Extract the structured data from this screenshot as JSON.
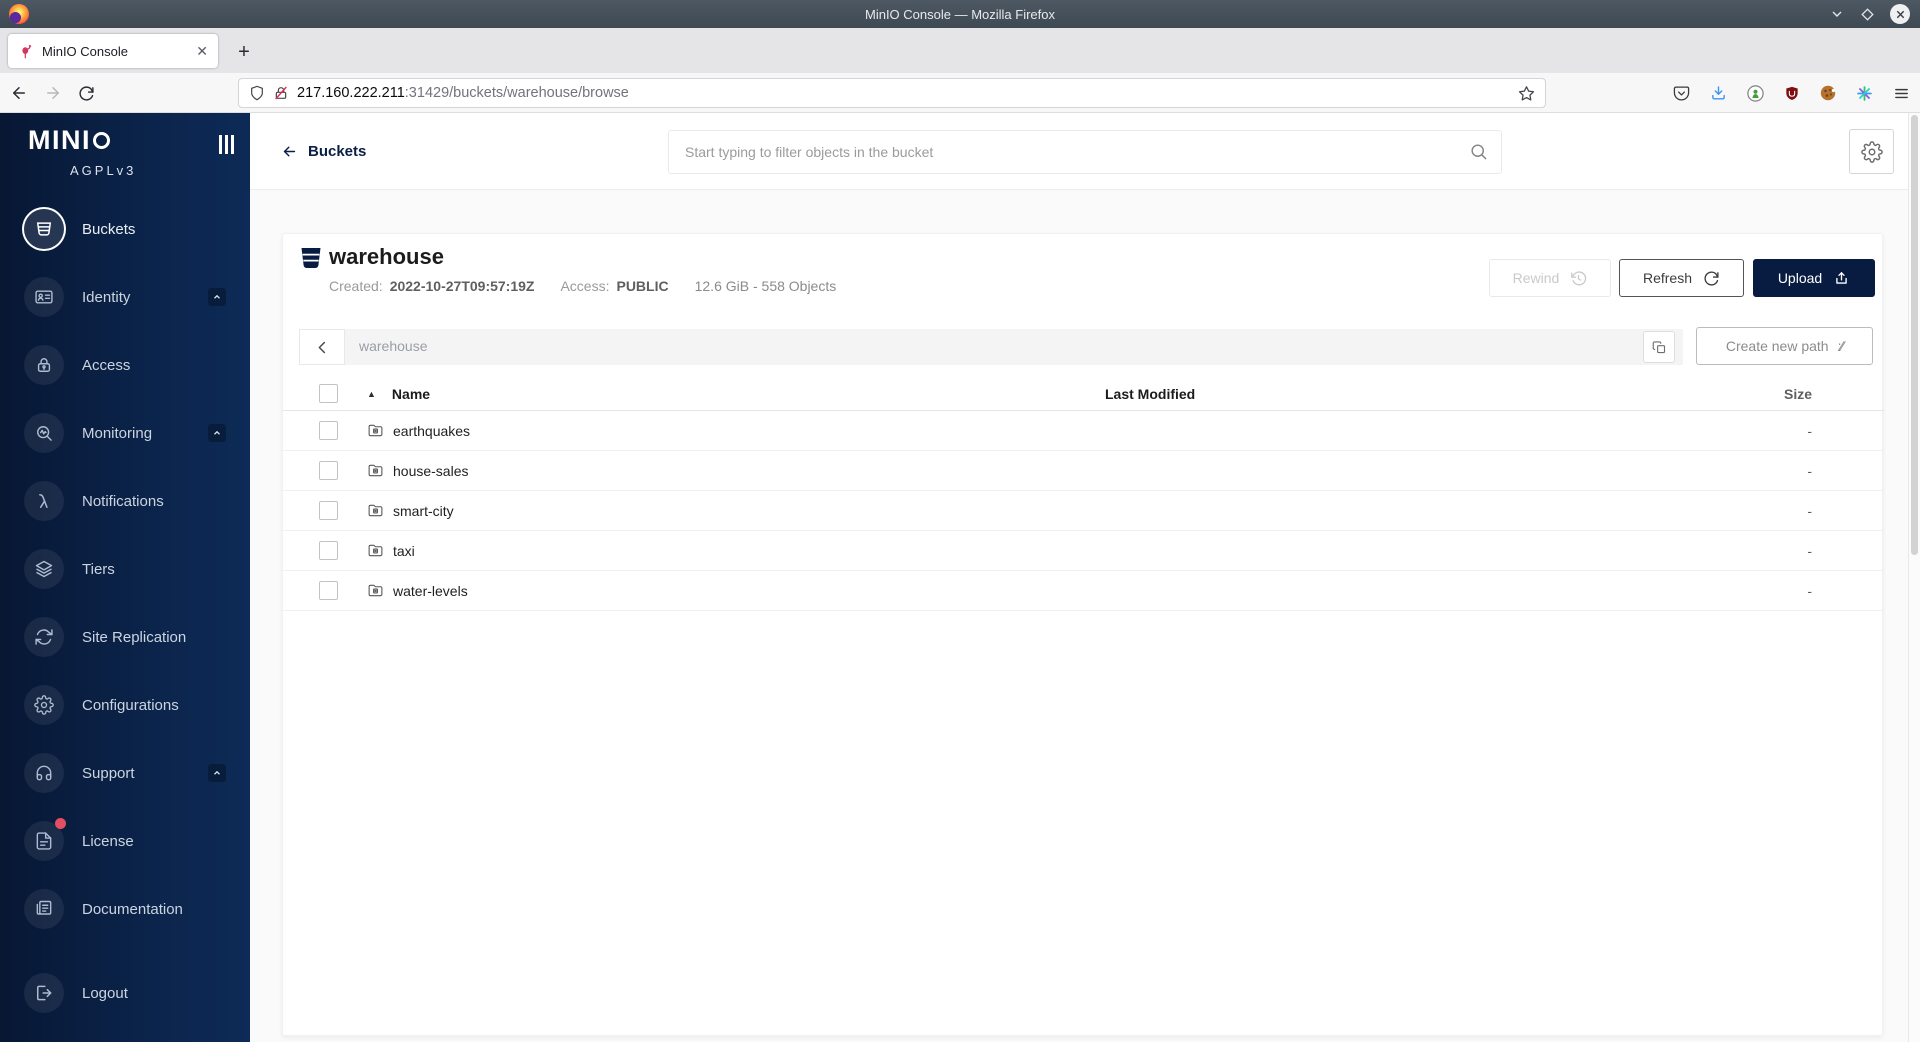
{
  "window": {
    "title": "MinIO Console — Mozilla Firefox"
  },
  "browser": {
    "tab_title": "MinIO Console",
    "url_host": "217.160.222.211",
    "url_rest": ":31429/buckets/warehouse/browse"
  },
  "sidebar": {
    "logo_text": "MINI",
    "license": "AGPLv3",
    "items": [
      {
        "label": "Buckets"
      },
      {
        "label": "Identity"
      },
      {
        "label": "Access"
      },
      {
        "label": "Monitoring"
      },
      {
        "label": "Notifications"
      },
      {
        "label": "Tiers"
      },
      {
        "label": "Site Replication"
      },
      {
        "label": "Configurations"
      },
      {
        "label": "Support"
      },
      {
        "label": "License"
      },
      {
        "label": "Documentation"
      },
      {
        "label": "Logout"
      }
    ]
  },
  "header": {
    "breadcrumb": "Buckets",
    "search_placeholder": "Start typing to filter objects in the bucket"
  },
  "bucket": {
    "name": "warehouse",
    "created_label": "Created:",
    "created_value": "2022-10-27T09:57:19Z",
    "access_label": "Access:",
    "access_value": "PUBLIC",
    "usage": "12.6 GiB - 558 Objects",
    "rewind_label": "Rewind",
    "refresh_label": "Refresh",
    "upload_label": "Upload"
  },
  "path_bar": {
    "current_path": "warehouse",
    "create_path_label": "Create new path"
  },
  "table": {
    "columns": {
      "name": "Name",
      "last_modified": "Last Modified",
      "size": "Size"
    },
    "rows": [
      {
        "name": "earthquakes",
        "size": "-"
      },
      {
        "name": "house-sales",
        "size": "-"
      },
      {
        "name": "smart-city",
        "size": "-"
      },
      {
        "name": "taxi",
        "size": "-"
      },
      {
        "name": "water-levels",
        "size": "-"
      }
    ]
  },
  "colors": {
    "navy": "#081c42",
    "sidebar_gradient_start": "#071734",
    "sidebar_gradient_end": "#0d2b57",
    "badge_red": "#e24f62",
    "titlebar": "#45515b",
    "download_blue": "#3b96f2"
  }
}
